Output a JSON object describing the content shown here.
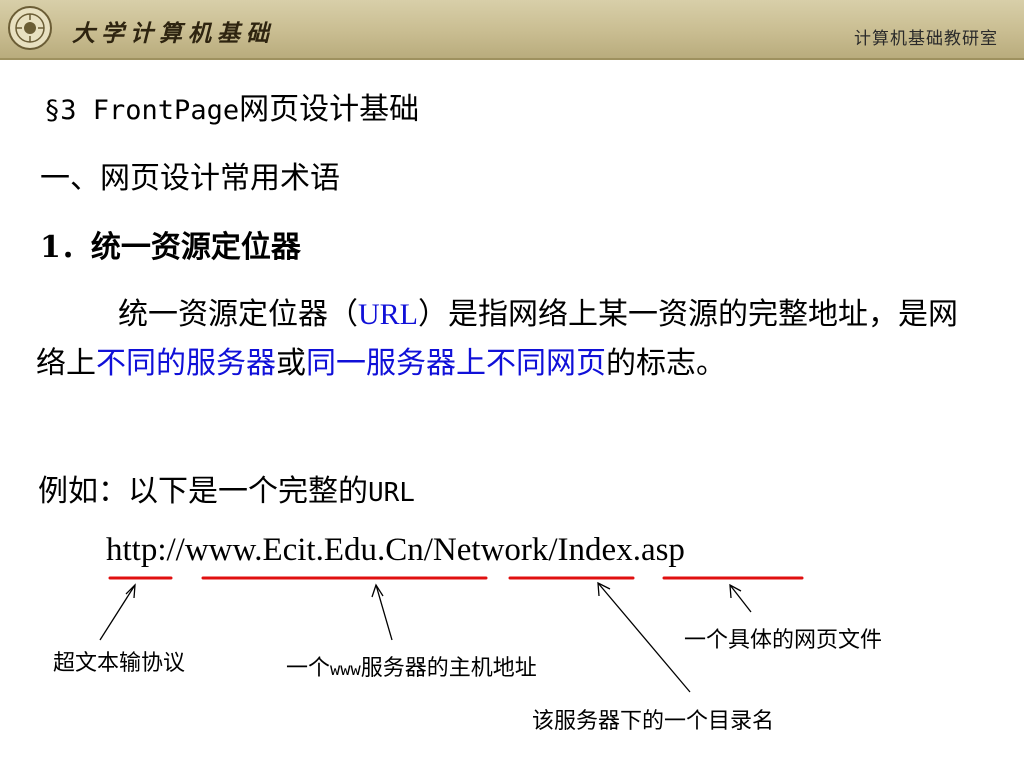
{
  "header": {
    "logo_text": "大学计算机基础",
    "department": "计算机基础教研室",
    "colors": {
      "band": "#c9bd91",
      "band_border": "#9e915f"
    }
  },
  "slide": {
    "section_title": {
      "symbol": "§3 ",
      "name": "FrontPage",
      "suffix": "网页设计基础"
    },
    "heading_1": "一、网页设计常用术语",
    "heading_2": "1．统一资源定位器",
    "paragraph": {
      "p1": "统一资源定位器（",
      "url_term": "URL",
      "p2": "）是指网络上某一资源的完整地址，是网络上",
      "hl1": "不同的服务器",
      "p3": "或",
      "hl2": "同一服务器上不同网页",
      "p4": "的标志。"
    },
    "example": {
      "text": "例如：以下是一个完整的",
      "term": "URL"
    },
    "url_example": "http://www.Ecit.Edu.Cn/Network/Index.asp",
    "labels": {
      "protocol": "超文本输协议",
      "host_prefix": "一个",
      "host_www": "www",
      "host_suffix": "服务器的主机地址",
      "directory": "该服务器下的一个目录名",
      "file": "一个具体的网页文件"
    },
    "colors": {
      "highlight": "#1010d8",
      "underline": "#e01010",
      "text": "#000000"
    }
  }
}
